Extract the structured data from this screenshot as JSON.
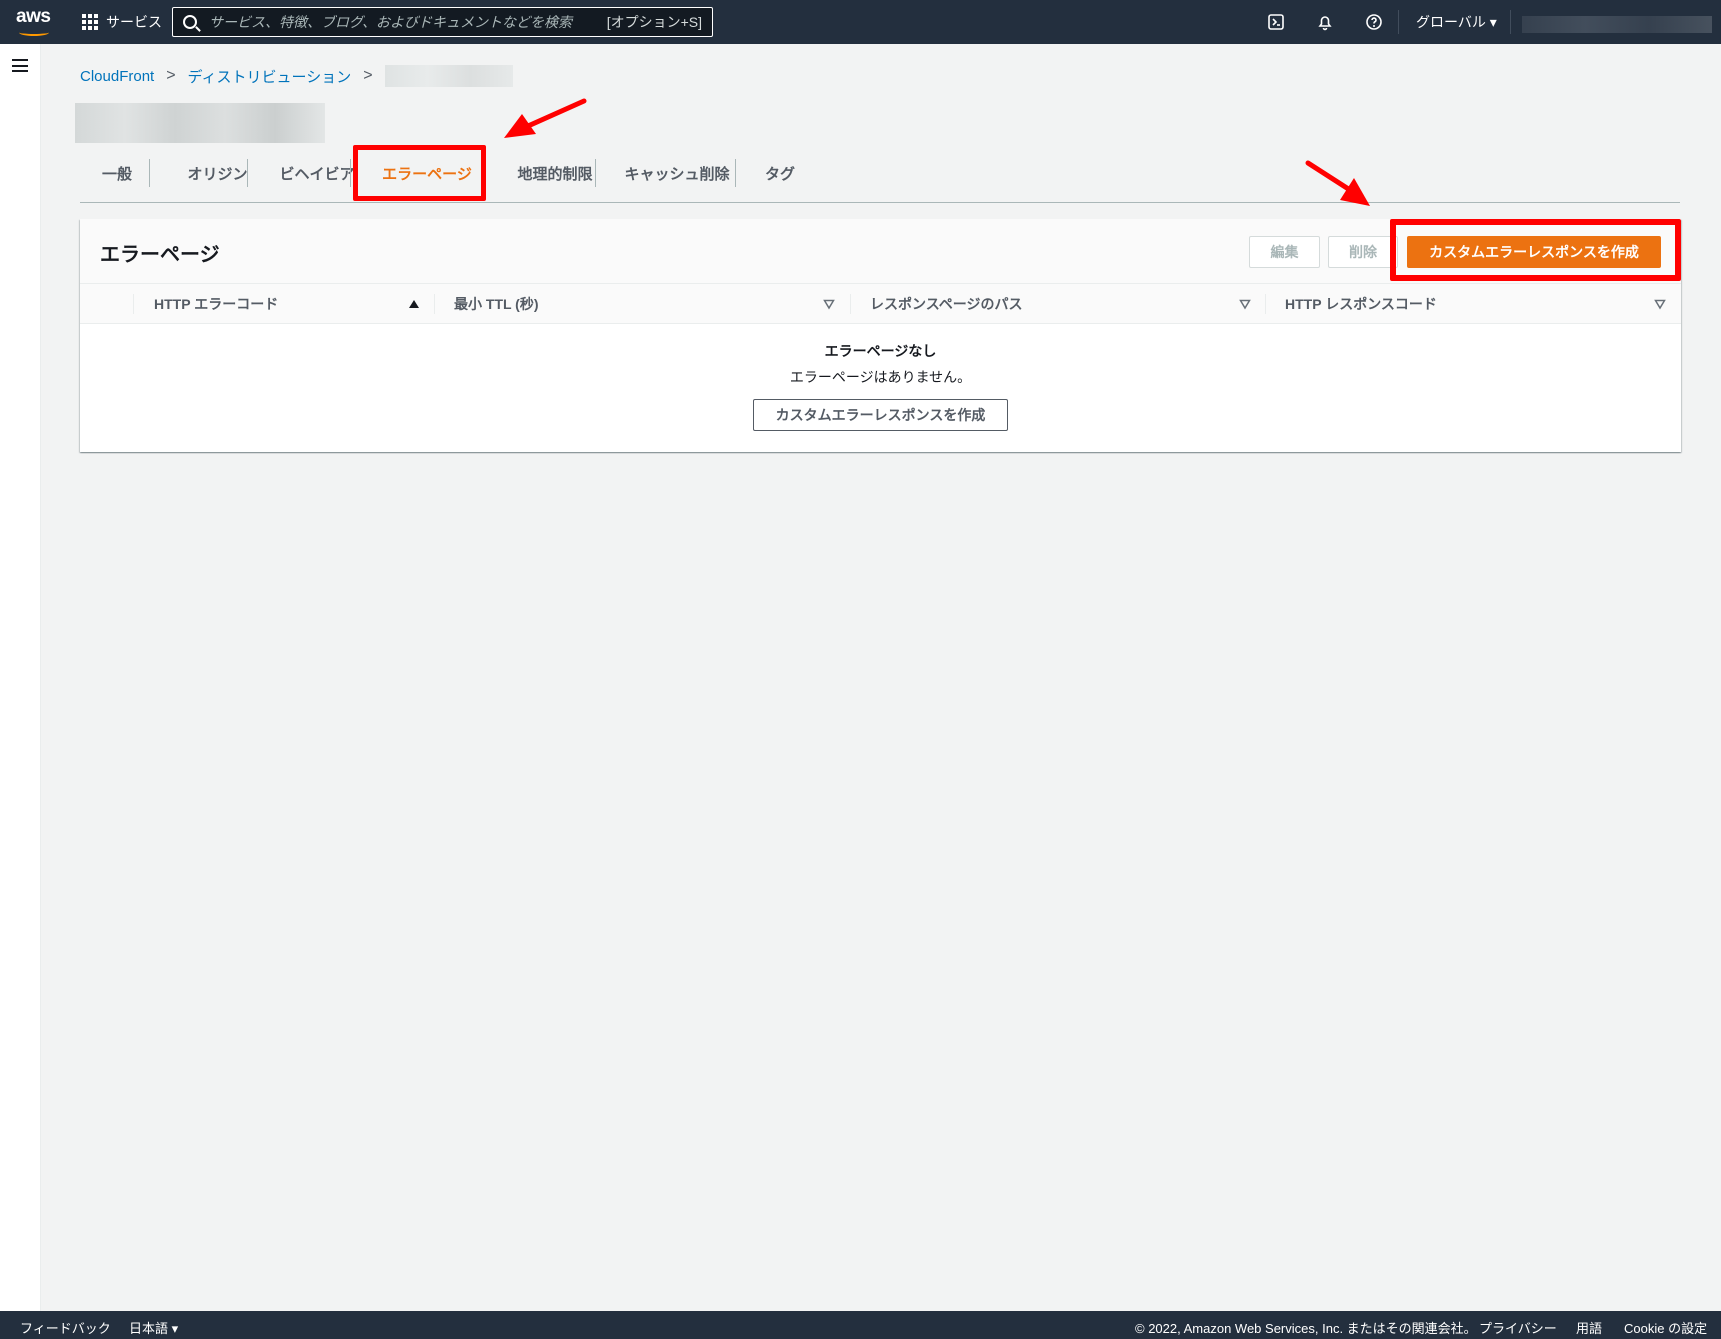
{
  "topnav": {
    "logo_text": "aws",
    "services_label": "サービス",
    "search_placeholder": "サービス、特徴、ブログ、およびドキュメントなどを検索",
    "search_shortcut": "[オプション+S]",
    "region_label": "グローバル ▾",
    "icons": [
      "cloudshell-icon",
      "bell-icon",
      "help-icon"
    ]
  },
  "breadcrumb": {
    "items": [
      "CloudFront",
      "ディストリビューション"
    ],
    "separator": ">"
  },
  "tabs": [
    {
      "label": "一般",
      "active": false
    },
    {
      "label": "オリジン",
      "active": false
    },
    {
      "label": "ビヘイビア",
      "active": false
    },
    {
      "label": "エラーページ",
      "active": true
    },
    {
      "label": "地理的制限",
      "active": false
    },
    {
      "label": "キャッシュ削除",
      "active": false
    },
    {
      "label": "タグ",
      "active": false
    }
  ],
  "panel": {
    "title": "エラーページ",
    "edit_label": "編集",
    "delete_label": "削除",
    "create_label": "カスタムエラーレスポンスを作成"
  },
  "table": {
    "columns": [
      "HTTP エラーコード",
      "最小 TTL (秒)",
      "レスポンスページのパス",
      "HTTP レスポンスコード"
    ],
    "empty_title": "エラーページなし",
    "empty_text": "エラーページはありません。",
    "empty_action": "カスタムエラーレスポンスを作成"
  },
  "footer": {
    "feedback": "フィードバック",
    "language": "日本語 ▾",
    "copyright": "© 2022, Amazon Web Services, Inc. またはその関連会社。",
    "privacy": "プライバシー",
    "terms": "用語",
    "cookie": "Cookie の設定"
  },
  "colors": {
    "nav_bg": "#232f3e",
    "accent_orange": "#ec7211",
    "link_blue": "#0073bb",
    "annotation_red": "#ff0000"
  }
}
